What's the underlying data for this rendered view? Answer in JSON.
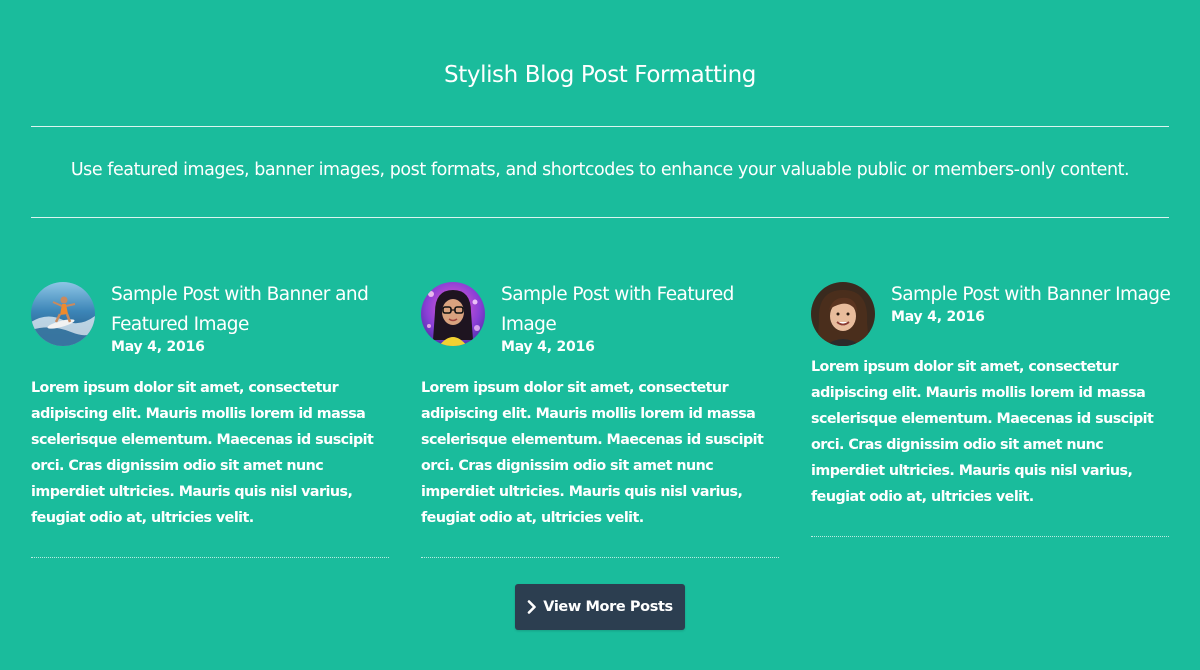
{
  "section": {
    "title": "Stylish Blog Post Formatting",
    "subtitle": "Use featured images, banner images, post formats, and shortcodes to enhance your valuable public or members-only content."
  },
  "posts": [
    {
      "title": "Sample Post with Banner and Featured Image",
      "date": "May 4, 2016",
      "excerpt": "Lorem ipsum dolor sit amet, consectetur adipiscing elit. Mauris mollis lorem id massa scelerisque elementum. Maecenas id suscipit orci. Cras dignissim odio sit amet nunc imperdiet ultricies. Mauris quis nisl varius, feugiat odio at, ultricies velit.",
      "avatar_icon": "surfer-avatar"
    },
    {
      "title": "Sample Post with Featured Image",
      "date": "May 4, 2016",
      "excerpt": "Lorem ipsum dolor sit amet, consectetur adipiscing elit. Mauris mollis lorem id massa scelerisque elementum. Maecenas id suscipit orci. Cras dignissim odio sit amet nunc imperdiet ultricies. Mauris quis nisl varius, feugiat odio at, ultricies velit.",
      "avatar_icon": "woman-glasses-avatar"
    },
    {
      "title": "Sample Post with Banner Image",
      "date": "May 4, 2016",
      "excerpt": "Lorem ipsum dolor sit amet, consectetur adipiscing elit. Mauris mollis lorem id massa scelerisque elementum. Maecenas id suscipit orci. Cras dignissim odio sit amet nunc imperdiet ultricies. Mauris quis nisl varius, feugiat odio at, ultricies velit.",
      "avatar_icon": "woman-avatar"
    }
  ],
  "more_button": {
    "label": "View More Posts",
    "icon": "chevron-right-icon"
  },
  "colors": {
    "background": "#1abc9c",
    "button": "#2c3e50",
    "text": "#ffffff"
  }
}
